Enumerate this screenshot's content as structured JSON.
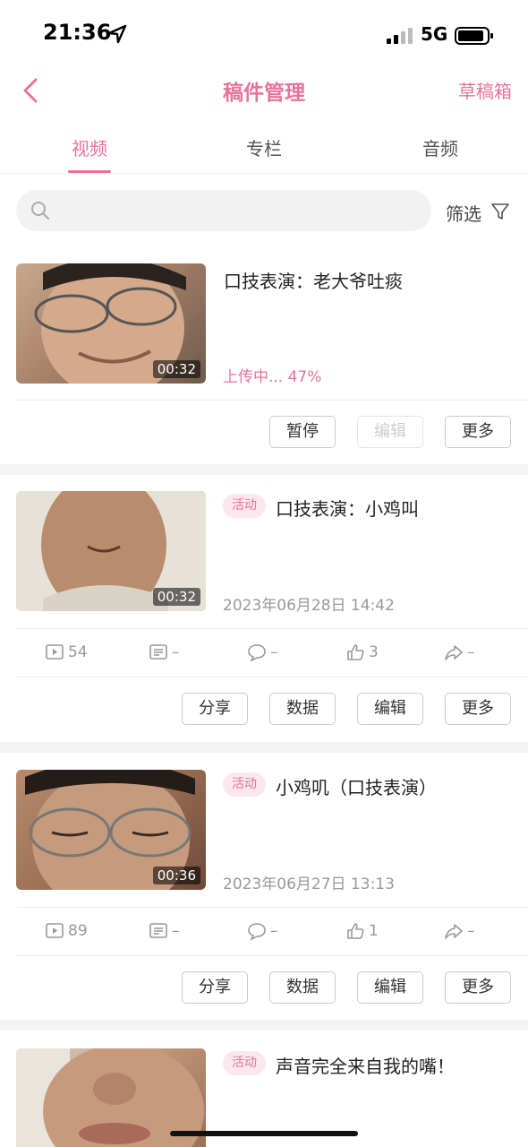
{
  "status_bar": {
    "time": "21:36",
    "network": "5G"
  },
  "nav": {
    "title": "稿件管理",
    "drafts_label": "草稿箱"
  },
  "tabs": [
    {
      "label": "视频"
    },
    {
      "label": "专栏"
    },
    {
      "label": "音频"
    }
  ],
  "search": {
    "placeholder": "",
    "filter_label": "筛选"
  },
  "colors": {
    "accent": "#e8739a",
    "badge_bg": "#fbe8ef"
  },
  "cards": [
    {
      "title": "口技表演：老大爷吐痰",
      "duration": "00:32",
      "upload_status": "上传中... 47%",
      "upload_progress_pct": 47,
      "buttons": {
        "pause": "暂停",
        "edit": "编辑",
        "more": "更多"
      }
    },
    {
      "badge": "活动",
      "title": "口技表演：小鸡叫",
      "duration": "00:32",
      "date": "2023年06月28日 14:42",
      "stats": {
        "plays": "54",
        "danmaku": "–",
        "comments": "–",
        "likes": "3",
        "shares": "–"
      },
      "buttons": {
        "share": "分享",
        "data": "数据",
        "edit": "编辑",
        "more": "更多"
      }
    },
    {
      "badge": "活动",
      "title": "小鸡叽（口技表演）",
      "duration": "00:36",
      "date": "2023年06月27日 13:13",
      "stats": {
        "plays": "89",
        "danmaku": "–",
        "comments": "–",
        "likes": "1",
        "shares": "–"
      },
      "buttons": {
        "share": "分享",
        "data": "数据",
        "edit": "编辑",
        "more": "更多"
      }
    },
    {
      "badge": "活动",
      "title": "声音完全来自我的嘴！"
    }
  ]
}
